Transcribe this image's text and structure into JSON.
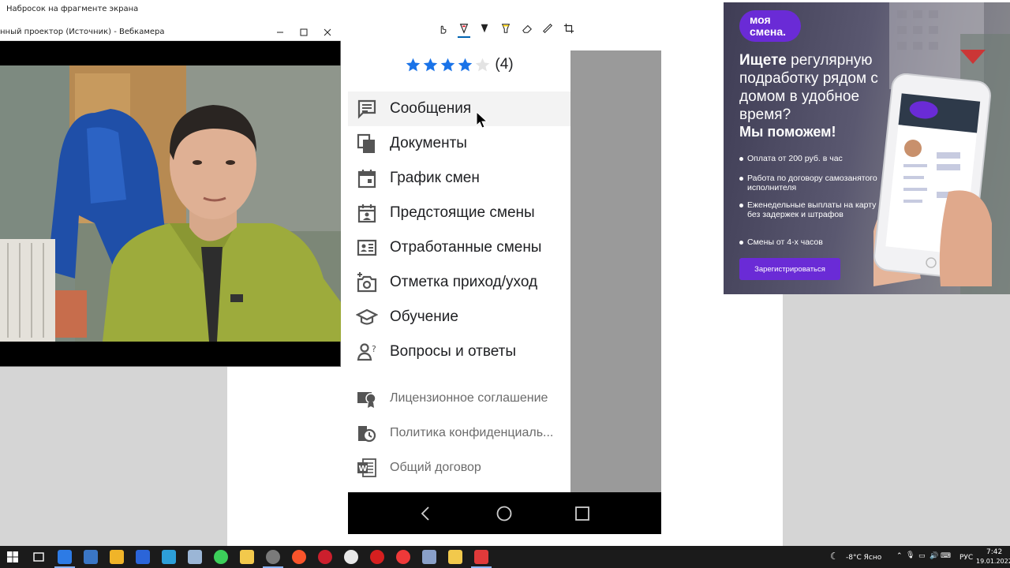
{
  "app": {
    "title": "Набросок на фрагменте экрана"
  },
  "toolbar": {
    "tools": [
      {
        "name": "touch-writing-icon"
      },
      {
        "name": "ballpoint-pen-icon",
        "active": true
      },
      {
        "name": "pencil-icon"
      },
      {
        "name": "highlighter-icon"
      },
      {
        "name": "eraser-icon"
      },
      {
        "name": "ruler-icon"
      },
      {
        "name": "crop-icon"
      }
    ]
  },
  "webcam_window": {
    "title": "нный проектор (Источник) - Вебкамера",
    "controls": [
      "minimize-icon",
      "maximize-icon",
      "close-icon"
    ]
  },
  "phone": {
    "rating": {
      "stars": 4,
      "max_stars": 5,
      "count_label": "(4)",
      "star_color": "#1a73e8"
    },
    "menu": [
      {
        "label": "Сообщения",
        "icon": "message-icon",
        "hovered": true
      },
      {
        "label": "Документы",
        "icon": "documents-icon"
      },
      {
        "label": "График смен",
        "icon": "calendar-icon"
      },
      {
        "label": "Предстоящие смены",
        "icon": "upcoming-shift-icon"
      },
      {
        "label": "Отработанные смены",
        "icon": "id-card-icon"
      },
      {
        "label": "Отметка приход/уход",
        "icon": "add-photo-icon"
      },
      {
        "label": "Обучение",
        "icon": "graduation-cap-icon"
      },
      {
        "label": "Вопросы и ответы",
        "icon": "person-question-icon"
      }
    ],
    "secondary_menu": [
      {
        "label": "Лицензионное соглашение",
        "icon": "license-badge-icon"
      },
      {
        "label": "Политика конфиденциаль...",
        "icon": "privacy-clock-icon"
      },
      {
        "label": "Общий договор",
        "icon": "word-document-icon"
      }
    ],
    "navbar": [
      "back-icon",
      "home-icon",
      "recents-icon"
    ]
  },
  "ad": {
    "logo": "моя\nсмена.",
    "headline_bold": "Ищете",
    "headline_rest": "регулярную подработку рядом с домом в удобное время?",
    "cta_text": "Мы поможем!",
    "bullets": [
      "Оплата от 200 руб. в час",
      "Работа по договору самозанятого исполнителя",
      "Еженедельные выплаты на карту без задержек и штрафов",
      "Смены от 4-х часов"
    ],
    "button_label": "Зарегистрироваться",
    "brand_color": "#6a2bd6"
  },
  "taskbar": {
    "apps": [
      "start-icon",
      "task-view-icon",
      "snip-sketch-icon",
      "calculator-icon",
      "explorer-icon",
      "calendar-app-icon",
      "photos-icon",
      "notepad-icon",
      "green-app-icon",
      "folder-icon",
      "obs-icon",
      "brave-icon",
      "opera-icon",
      "yandex-icon",
      "red-circle-icon",
      "vivaldi-icon",
      "camera-icon",
      "star-app-icon",
      "paint-icon"
    ],
    "weather": "-8°C Ясно",
    "language": "РУС",
    "time": "7:42",
    "date": "19.01.2022"
  }
}
